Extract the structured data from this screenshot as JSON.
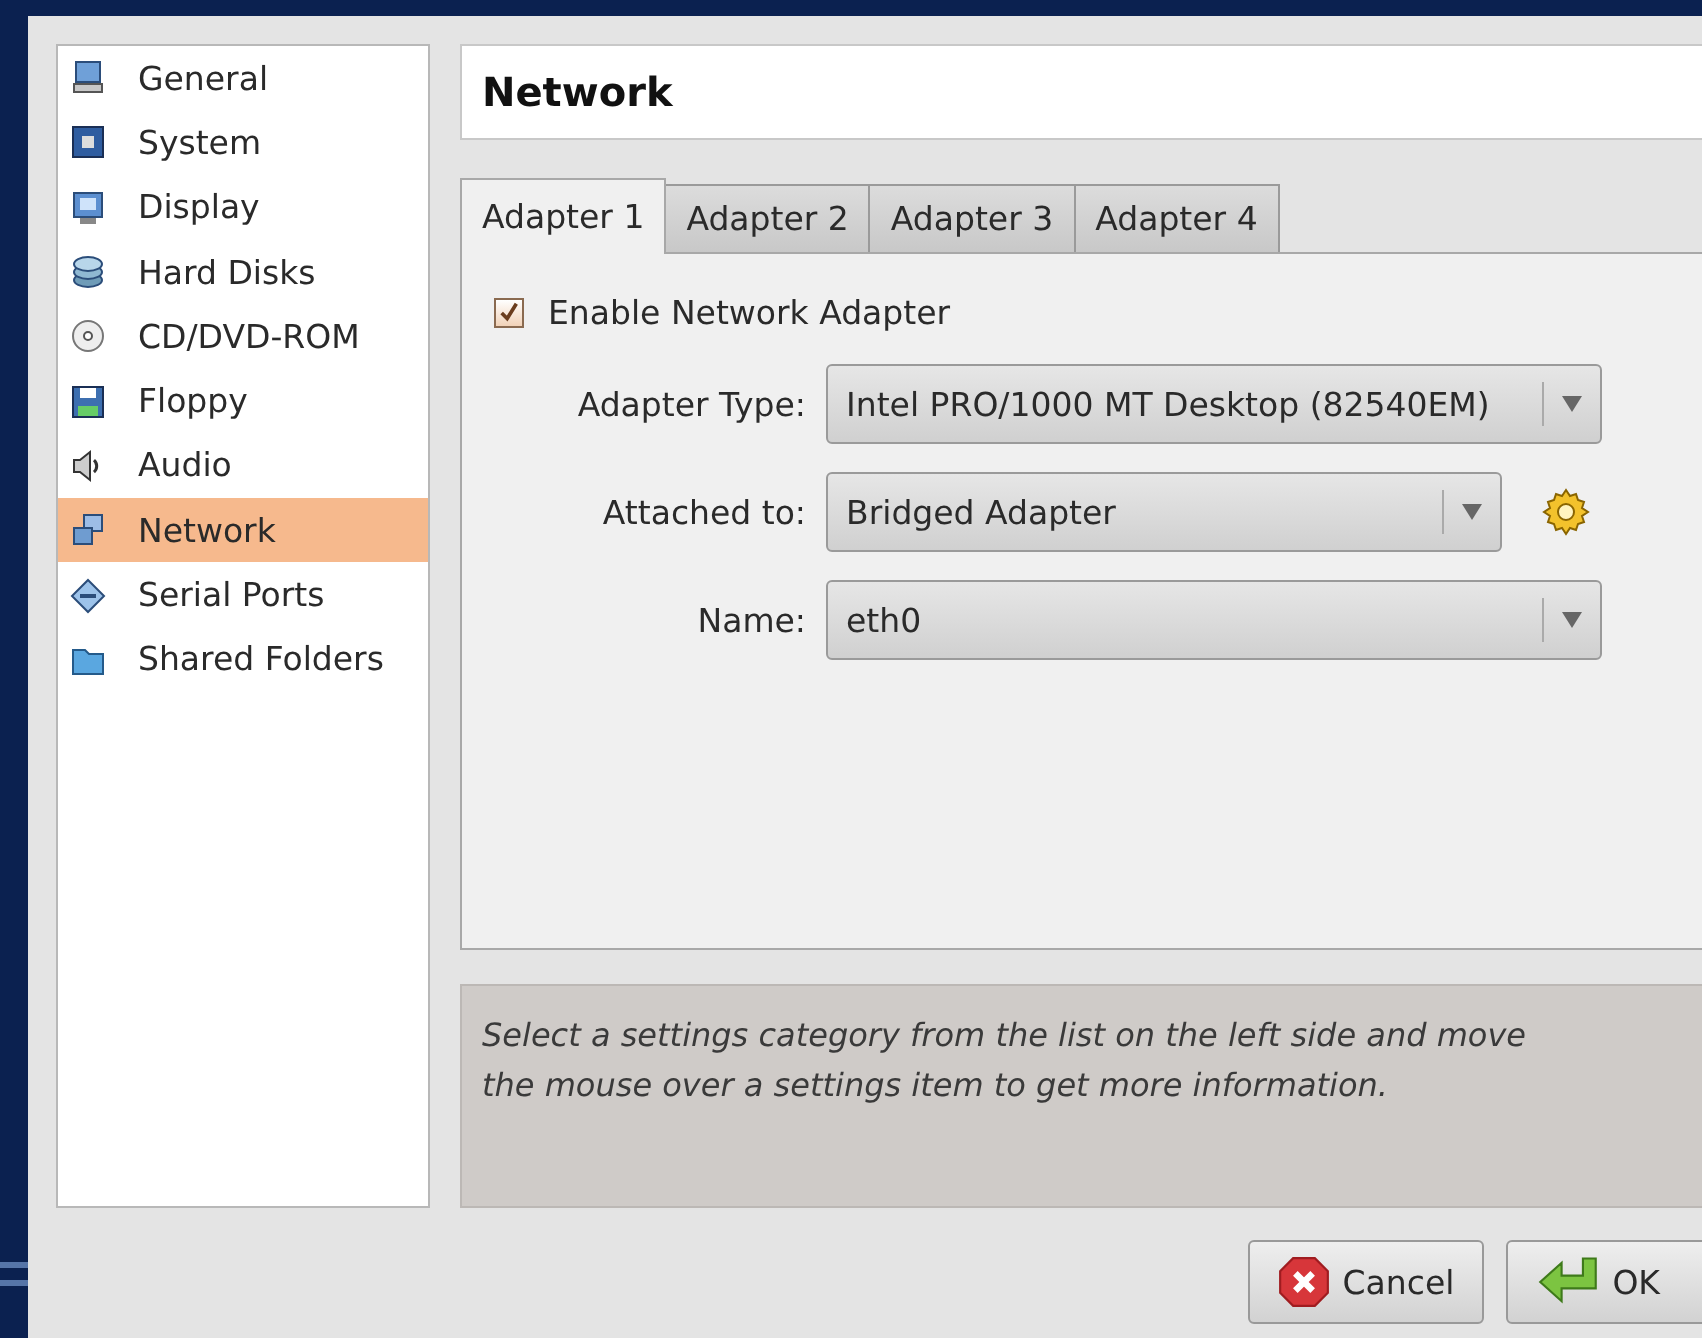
{
  "sidebar": {
    "items": [
      {
        "label": "General",
        "selected": false
      },
      {
        "label": "System",
        "selected": false
      },
      {
        "label": "Display",
        "selected": false
      },
      {
        "label": "Hard Disks",
        "selected": false
      },
      {
        "label": "CD/DVD-ROM",
        "selected": false
      },
      {
        "label": "Floppy",
        "selected": false
      },
      {
        "label": "Audio",
        "selected": false
      },
      {
        "label": "Network",
        "selected": true
      },
      {
        "label": "Serial Ports",
        "selected": false
      },
      {
        "label": "Shared Folders",
        "selected": false
      }
    ]
  },
  "page_title": "Network",
  "tabs": [
    {
      "label": "Adapter 1",
      "selected": true
    },
    {
      "label": "Adapter 2",
      "selected": false
    },
    {
      "label": "Adapter 3",
      "selected": false
    },
    {
      "label": "Adapter 4",
      "selected": false
    }
  ],
  "enable_adapter": {
    "label": "Enable Network Adapter",
    "checked": true
  },
  "fields": [
    {
      "label": "Adapter Type:",
      "value": "Intel PRO/1000 MT Desktop (82540EM)",
      "settings_button": false
    },
    {
      "label": "Attached to:",
      "value": "Bridged Adapter",
      "settings_button": true
    },
    {
      "label": "Name:",
      "value": "eth0",
      "settings_button": false
    }
  ],
  "info_text": "Select a settings category from the list on the left side and move the mouse over a settings item to get more information.",
  "buttons": [
    {
      "label": "Cancel",
      "kind": "cancel"
    },
    {
      "label": "OK",
      "kind": "ok"
    }
  ]
}
